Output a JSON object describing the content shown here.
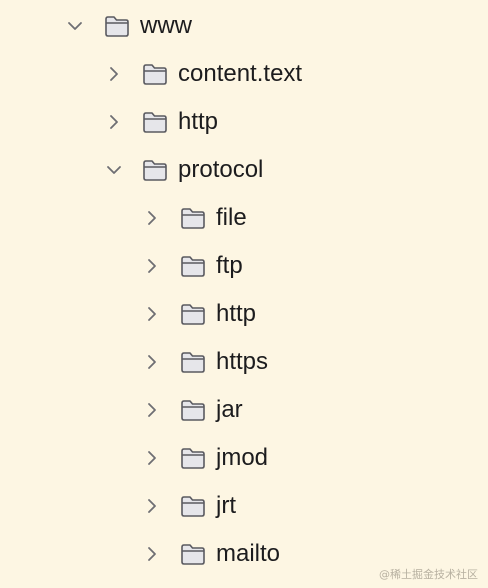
{
  "tree": {
    "items": [
      {
        "label": "www",
        "expanded": true,
        "icon": "folder-icon"
      },
      {
        "label": "content.text",
        "expanded": false,
        "icon": "folder-icon"
      },
      {
        "label": "http",
        "expanded": false,
        "icon": "folder-icon"
      },
      {
        "label": "protocol",
        "expanded": true,
        "icon": "folder-icon"
      },
      {
        "label": "file",
        "expanded": false,
        "icon": "folder-icon"
      },
      {
        "label": "ftp",
        "expanded": false,
        "icon": "folder-icon"
      },
      {
        "label": "http",
        "expanded": false,
        "icon": "folder-icon"
      },
      {
        "label": "https",
        "expanded": false,
        "icon": "folder-icon"
      },
      {
        "label": "jar",
        "expanded": false,
        "icon": "folder-icon"
      },
      {
        "label": "jmod",
        "expanded": false,
        "icon": "folder-icon"
      },
      {
        "label": "jrt",
        "expanded": false,
        "icon": "folder-icon"
      },
      {
        "label": "mailto",
        "expanded": false,
        "icon": "folder-icon"
      }
    ]
  },
  "watermark": "@稀土掘金技术社区",
  "colors": {
    "background": "#fdf6e3",
    "text": "#1c1c1e",
    "chevron": "#6e6e73",
    "folder_stroke": "#5a5a60",
    "folder_fill": "#e6e6ea"
  }
}
